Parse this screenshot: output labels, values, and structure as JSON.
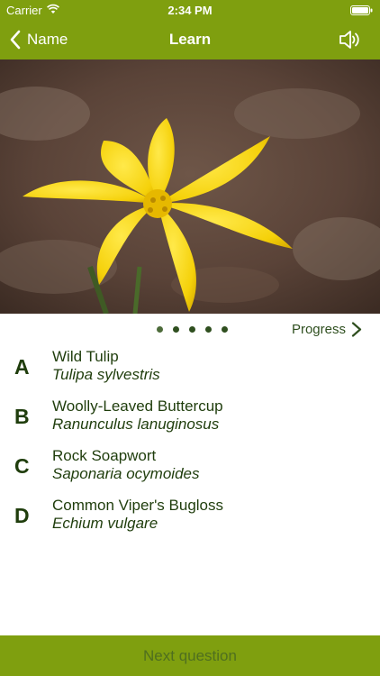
{
  "status_bar": {
    "carrier": "Carrier",
    "time": "2:34 PM"
  },
  "nav": {
    "back_label": "Name",
    "title": "Learn",
    "back_icon": "chevron-left-icon",
    "sound_icon": "speaker-icon"
  },
  "photo": {
    "subject": "yellow wild tulip flower",
    "subject_icon": "flower-photo"
  },
  "pager": {
    "count": 5,
    "active_index": 0
  },
  "progress": {
    "label": "Progress",
    "icon": "chevron-right-icon"
  },
  "answers": [
    {
      "letter": "A",
      "common": "Wild Tulip",
      "latin": "Tulipa sylvestris"
    },
    {
      "letter": "B",
      "common": "Woolly-Leaved Buttercup",
      "latin": "Ranunculus lanuginosus"
    },
    {
      "letter": "C",
      "common": "Rock Soapwort",
      "latin": "Saponaria ocymoides"
    },
    {
      "letter": "D",
      "common": "Common Viper's Bugloss",
      "latin": "Echium vulgare"
    }
  ],
  "footer": {
    "next_label": "Next question"
  },
  "colors": {
    "bar_green": "#7f9f0f",
    "text_dark_green": "#1f3d0c",
    "footer_text": "#4f6f1f"
  }
}
